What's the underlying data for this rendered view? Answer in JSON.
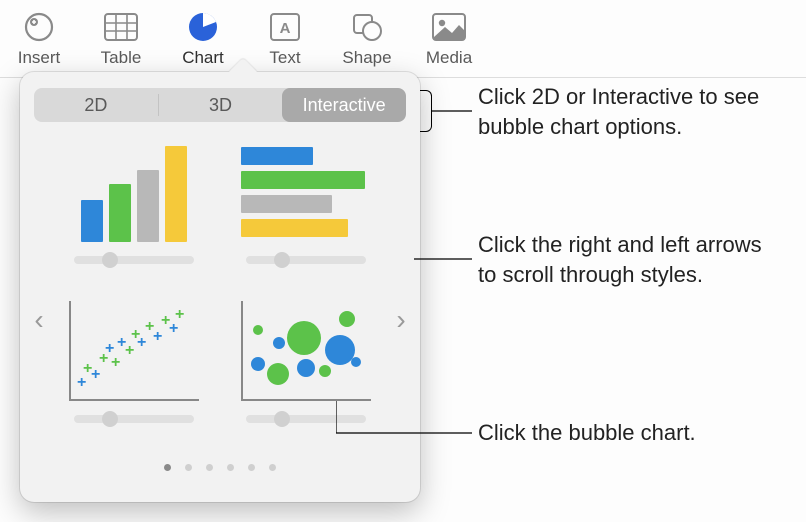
{
  "toolbar": {
    "insert": "Insert",
    "table": "Table",
    "chart": "Chart",
    "text": "Text",
    "shape": "Shape",
    "media": "Media"
  },
  "seg": {
    "d2": "2D",
    "d3": "3D",
    "interactive": "Interactive"
  },
  "callouts": {
    "a": "Click 2D or Interactive to see bubble chart options.",
    "b": "Click the right and left arrows to scroll through styles.",
    "c": "Click the bubble chart."
  },
  "nav": {
    "left": "‹",
    "right": "›"
  },
  "colors": {
    "blue": "#2e87d9",
    "green": "#5cc24a",
    "grey": "#b8b8b8",
    "yellow": "#f5c93a"
  }
}
